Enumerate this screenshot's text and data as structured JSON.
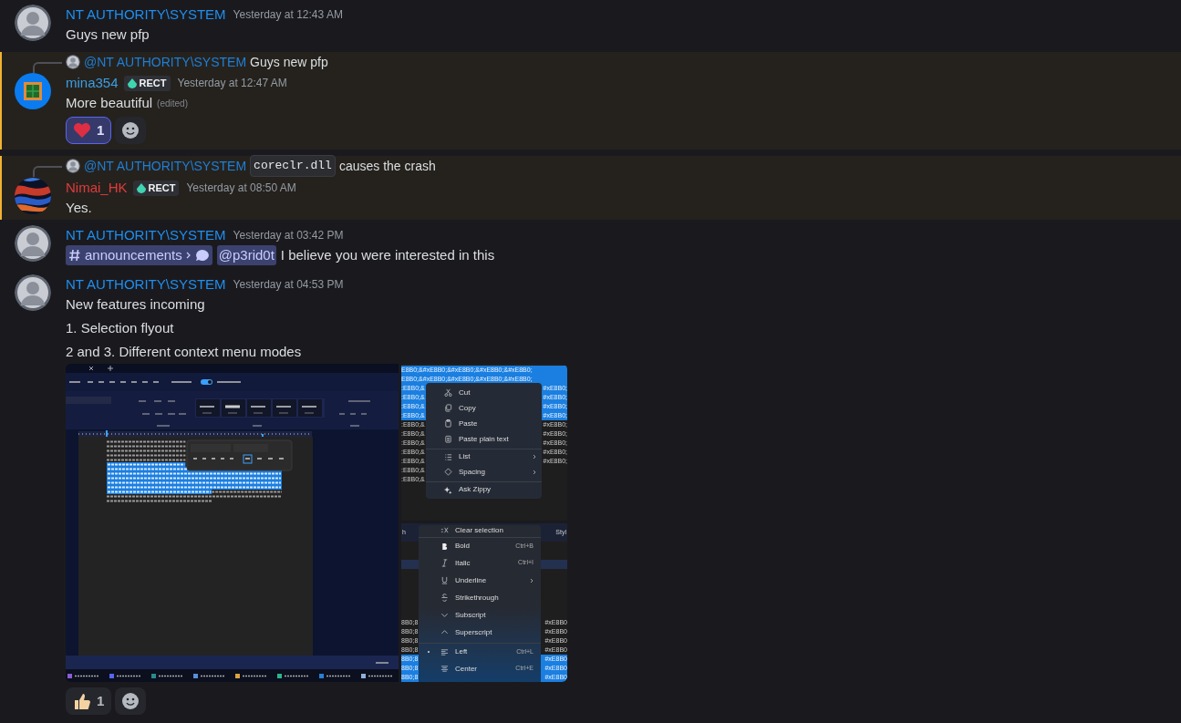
{
  "messages": [
    {
      "author": "NT AUTHORITY\\SYSTEM",
      "color": "#1f8ff0",
      "highlighted": false,
      "time": "Yesterday at 12:43 AM",
      "content": [
        [
          {
            "kind": "text",
            "text": "Guys new pfp"
          }
        ]
      ]
    },
    {
      "reply": {
        "author": "@NT AUTHORITY\\SYSTEM",
        "color": "#1f7fd6",
        "content": [
          {
            "kind": "text",
            "text": "Guys new pfp"
          }
        ]
      },
      "author": "mina354",
      "color": "#3d9de0",
      "tag": "RECT",
      "highlighted": true,
      "time": "Yesterday at 12:47 AM",
      "content": [
        [
          {
            "kind": "text",
            "text": "More beautiful"
          },
          {
            "kind": "edited",
            "text": "(edited)"
          }
        ]
      ],
      "reactions": [
        {
          "count": "1",
          "selected": true
        }
      ]
    },
    {
      "reply": {
        "author": "@NT AUTHORITY\\SYSTEM",
        "color": "#1f7fd6",
        "content": [
          {
            "kind": "code",
            "text": "coreclr.dll"
          },
          {
            "kind": "text",
            "text": "causes the crash"
          }
        ]
      },
      "author": "Nimai_HK",
      "color": "#e03b3b",
      "tag": "RECT",
      "highlighted": true,
      "time": "Yesterday at 08:50 AM",
      "content": [
        [
          {
            "kind": "text",
            "text": "Yes."
          }
        ]
      ]
    },
    {
      "author": "NT AUTHORITY\\SYSTEM",
      "color": "#1f8ff0",
      "highlighted": false,
      "time": "Yesterday at 03:42 PM",
      "content": [
        [
          {
            "kind": "channel",
            "text": "announcements"
          },
          {
            "kind": "mention",
            "text": "@p3rid0t"
          },
          {
            "kind": "text",
            "text": "I believe you were interested in this"
          }
        ]
      ]
    },
    {
      "author": "NT AUTHORITY\\SYSTEM",
      "color": "#1f8ff0",
      "highlighted": false,
      "time": "Yesterday at 04:53 PM",
      "content": [
        [
          {
            "kind": "text",
            "text": "New features incoming"
          }
        ],
        [
          {
            "kind": "text",
            "text": "1. Selection flyout"
          }
        ],
        [
          {
            "kind": "text",
            "text": "2 and 3. Different context menu modes"
          }
        ]
      ],
      "attachments": [
        {
          "kind": "editor",
          "autosave_on": true
        },
        {
          "kind": "menu",
          "backdrop": [
            {
              "left": "E8B0;&#xE8B0;&#xE8B0;&#xE8B0;&#xE8B0;",
              "selected": true
            },
            {
              "left": "E8B0;&#xE8B0;&#xE8B0;&#xE8B0;&#xE8B0;",
              "selected": true
            },
            {
              "left": ":E8B0;&",
              "right": "#xE8B0;",
              "selected": true
            },
            {
              "left": ":E8B0;&",
              "right": "#xE8B0;",
              "selected": true
            },
            {
              "left": ":E8B0;&",
              "right": "#xE8B0;",
              "selected": true
            },
            {
              "left": ":E8B0;&",
              "right": "#xE8B0;",
              "selected": true
            },
            {
              "left": ":E8B0;&",
              "right": "#xE8B0;",
              "selected": false
            },
            {
              "left": ":E8B0;&",
              "right": "#xE8B0;",
              "selected": false
            },
            {
              "left": ":E8B0;&",
              "right": "#xE8B0;",
              "selected": false
            },
            {
              "left": ":E8B0;&",
              "right": "#xE8B0;",
              "selected": false
            },
            {
              "left": ":E8B0;&",
              "right": "#xE8B0;",
              "selected": false
            },
            {
              "left": ":E8B0;&",
              "selected": false
            },
            {
              "left": ":E8B0;&",
              "selected": false
            }
          ],
          "items": [
            {
              "label": "Cut"
            },
            {
              "label": "Copy"
            },
            {
              "label": "Paste"
            },
            {
              "label": "Paste plain text"
            },
            {
              "label": "List",
              "submenu": true,
              "separator": true
            },
            {
              "label": "Spacing",
              "submenu": true
            },
            {
              "label": "Ask Zippy",
              "separator": true
            }
          ]
        },
        {
          "kind": "menu2",
          "ribbon_left": "h",
          "ribbon_right": "Styl",
          "backdrop": [
            {
              "left": "8B0;8",
              "right": "#xE8B0",
              "selected": false
            },
            {
              "left": "8B0;8",
              "right": "#xE8B0",
              "selected": false
            },
            {
              "left": "8B0;8",
              "right": "#xE8B0",
              "selected": false
            },
            {
              "left": "8B0;8",
              "right": "#xE8B0",
              "selected": false
            },
            {
              "left": "8B0;8",
              "right": "#xE8B0",
              "selected": true
            },
            {
              "left": "8B0;8",
              "right": "#xE8B0",
              "selected": true
            },
            {
              "left": "8B0;8",
              "right": "#xE8B0",
              "selected": true
            }
          ],
          "items": [
            {
              "label": "Clear selection",
              "checked": false
            },
            {
              "label": "Bold",
              "shortcut": "Ctrl+B",
              "separator": true,
              "checked": false
            },
            {
              "label": "Italic",
              "shortcut": "Ctrl+I",
              "checked": false
            },
            {
              "label": "Underline",
              "submenu": true,
              "checked": false
            },
            {
              "label": "Strikethrough",
              "checked": false
            },
            {
              "label": "Subscript",
              "checked": false
            },
            {
              "label": "Superscript",
              "checked": false
            },
            {
              "label": "Left",
              "shortcut": "Ctrl+L",
              "separator": true,
              "checked": true
            },
            {
              "label": "Center",
              "shortcut": "Ctrl+E",
              "checked": false
            }
          ]
        }
      ],
      "reactions": [
        {
          "count": "1",
          "selected": false
        }
      ]
    }
  ]
}
